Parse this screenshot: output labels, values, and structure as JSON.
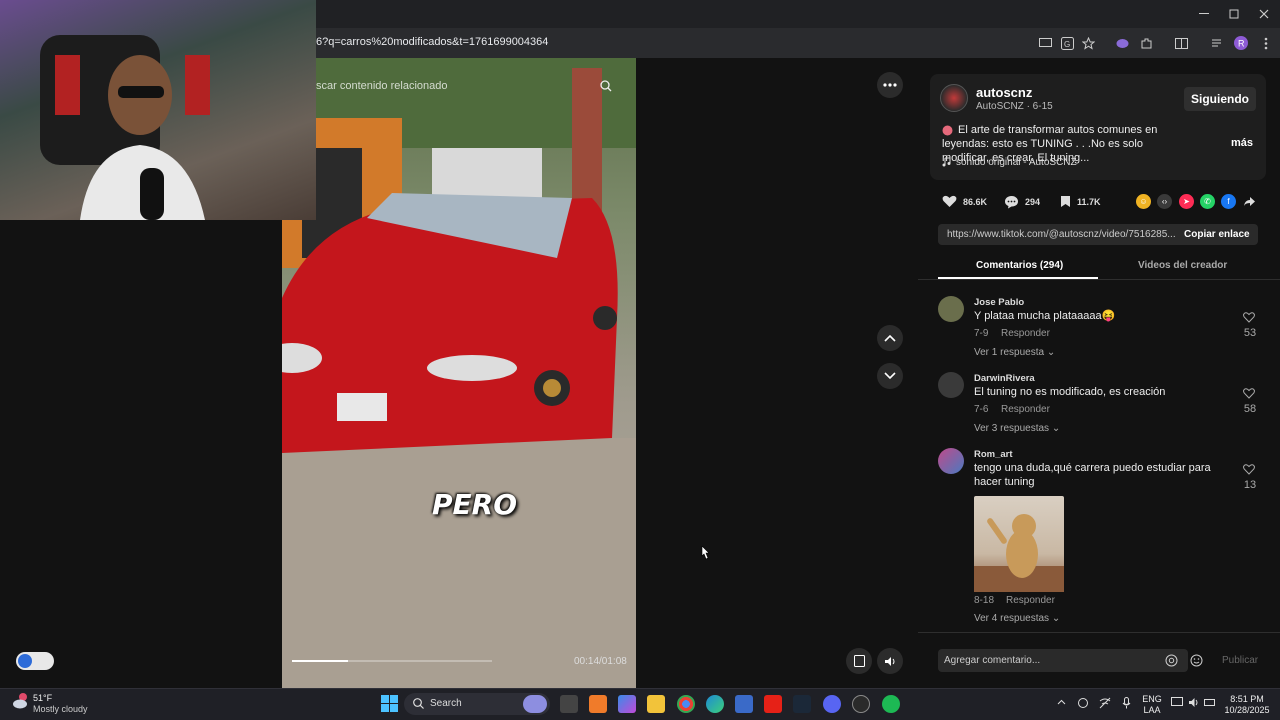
{
  "browser": {
    "url": "6?q=carros%20modificados&t=1761699004364"
  },
  "video": {
    "search_overlay": "scar contenido relacionado",
    "caption": "PERO",
    "time": "00:14/01:08"
  },
  "post": {
    "username": "autoscnz",
    "subline": "AutoSCNZ · 6-15",
    "follow_label": "Siguiendo",
    "description": "El arte de transformar autos comunes en leyendas: esto es TUNING . . .No es solo modificar, es crear. El tuning...",
    "more_label": "más",
    "sound": "sonido original - AutoSCNZ",
    "likes": "86.6K",
    "comments": "294",
    "saves": "11.7K",
    "link_url": "https://www.tiktok.com/@autoscnz/video/7516285...",
    "copy_label": "Copiar enlace"
  },
  "tabs": {
    "comments": "Comentarios (294)",
    "creator_videos": "Videos del creador"
  },
  "comments": [
    {
      "name": "Jose Pablo",
      "text": "Y plataa mucha plataaaaa😝",
      "date": "7-9",
      "reply": "Responder",
      "replies": "Ver 1 respuesta",
      "likes": "53"
    },
    {
      "name": "DarwinRivera",
      "text": "El tuning no es modificado, es creación",
      "date": "7-6",
      "reply": "Responder",
      "replies": "Ver 3 respuestas",
      "likes": "58"
    },
    {
      "name": "Rom_art",
      "text": "tengo una duda,qué carrera puedo estudiar para hacer tuning",
      "date": "8-18",
      "reply": "Responder",
      "replies": "Ver 4 respuestas",
      "likes": "13"
    }
  ],
  "comment_input": {
    "placeholder": "Agregar comentario...",
    "publish": "Publicar"
  },
  "taskbar": {
    "temp": "51°F",
    "weather": "Mostly cloudy",
    "search": "Search",
    "lang1": "ENG",
    "lang2": "LAA",
    "time": "8:51 PM",
    "date": "10/28/2025"
  },
  "colors": {
    "accent_pink": "#fe2c55",
    "panel_bg": "#121212"
  }
}
